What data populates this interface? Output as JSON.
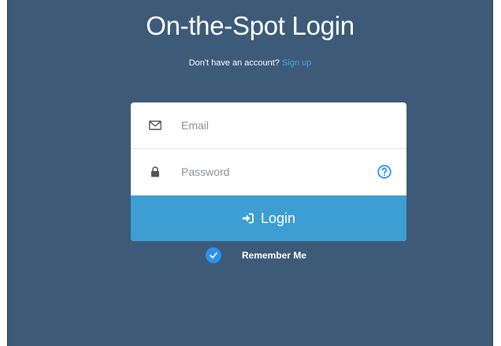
{
  "page": {
    "title": "On-the-Spot Login",
    "signup_prompt": "Don't have an account?",
    "signup_link": "Sign up"
  },
  "form": {
    "email": {
      "icon": "envelope-icon",
      "placeholder": "Email",
      "value": ""
    },
    "password": {
      "icon": "lock-icon",
      "placeholder": "Password",
      "value": "",
      "help_icon": "question-circle-icon"
    },
    "login_button": {
      "icon": "sign-in-icon",
      "label": "Login"
    },
    "remember_me": {
      "checked": true,
      "label": "Remember Me"
    }
  },
  "colors": {
    "background": "#3d5a78",
    "accent": "#3c9ed2",
    "link": "#3fa9e2",
    "checkbox": "#2d8ff0"
  }
}
